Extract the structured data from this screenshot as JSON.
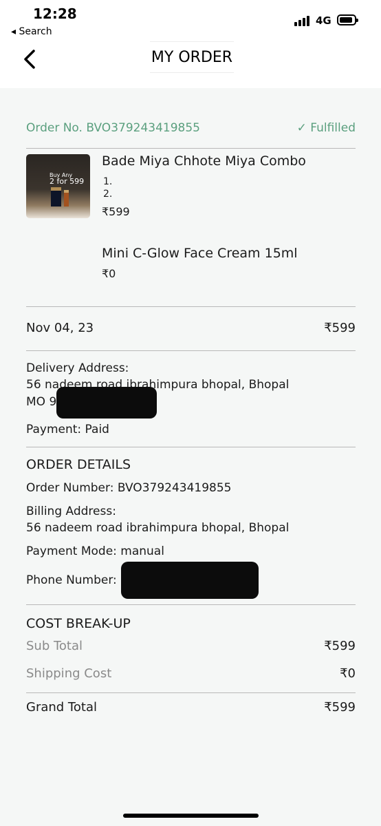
{
  "status_bar": {
    "time": "12:28",
    "back_app": "◂ Search",
    "network": "4G"
  },
  "nav": {
    "title": "MY ORDER"
  },
  "order": {
    "number_label": "Order No. BVO379243419855",
    "status": "✓ Fulfilled",
    "items": [
      {
        "name": "Bade Miya Chhote Miya Combo",
        "sub_items": [
          "1.",
          "2."
        ],
        "price": "₹599",
        "thumb_promo_line1": "Buy Any",
        "thumb_promo_line2": "2 for 599"
      },
      {
        "name": "Mini C-Glow Face Cream 15ml",
        "price": "₹0"
      }
    ],
    "date": "Nov 04, 23",
    "total": "₹599"
  },
  "delivery": {
    "label": "Delivery Address:",
    "line1": "56 nadeem road ibrahimpura bhopal, Bhopal",
    "line2": "MO 90",
    "payment": "Payment: Paid"
  },
  "order_details": {
    "title": "ORDER DETAILS",
    "order_number": "Order Number: BVO379243419855",
    "billing_label": "Billing Address:",
    "billing_address": "56 nadeem road ibrahimpura bhopal, Bhopal",
    "payment_mode": "Payment Mode: manual",
    "phone_label": "Phone Number: 90"
  },
  "cost": {
    "title": "COST BREAK-UP",
    "sub_total_label": "Sub Total",
    "sub_total": "₹599",
    "shipping_label": "Shipping Cost",
    "shipping": "₹0",
    "grand_total_label": "Grand Total",
    "grand_total": "₹599"
  }
}
